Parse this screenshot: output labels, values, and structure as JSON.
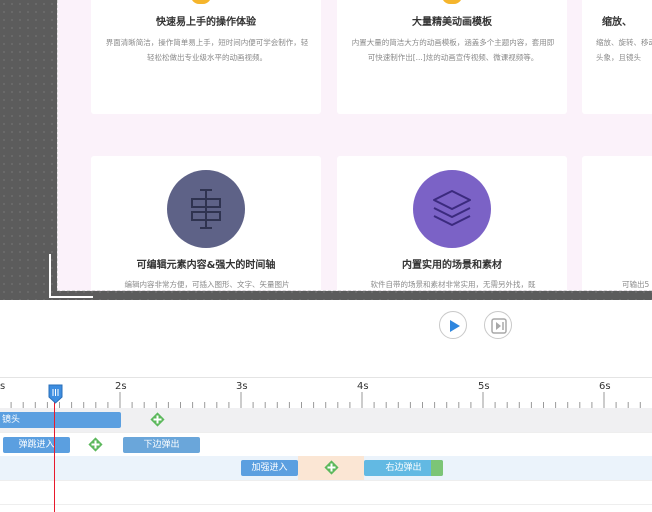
{
  "cards": [
    {
      "title": "快速易上手的操作体验",
      "desc": "界面清晰简洁，操作简单易上手，短时间内便可学会制作，轻轻松松做出专业级水平的动画视频。"
    },
    {
      "title": "大量精美动画模板",
      "desc": "内置大量的简洁大方的动画模板，涵盖多个主题内容，套用即可快速制作出[...]炫的动画宣传视频、微课视频等。"
    },
    {
      "title": "缩放、",
      "desc": "缩放、旋转、移动头象，且镜头"
    },
    {
      "title": "可编辑元素内容&强大的时间轴",
      "desc": "编辑内容非常方便，可插入图形、文字、矢量图片",
      "icon": "signpost-icon",
      "icon_color": "#5e6287"
    },
    {
      "title": "内置实用的场景和素材",
      "desc": "软件自带的场景和素材非常实用，无需另外找，既",
      "icon": "layers-icon",
      "icon_color": "#7b62c6"
    },
    {
      "title": "",
      "desc": "可输出5"
    }
  ],
  "controls": {
    "play_icon": "play-icon",
    "next_icon": "next-frame-icon",
    "accent": "#2e86de"
  },
  "ruler": {
    "labels": [
      "s",
      "2s",
      "3s",
      "4s",
      "5s",
      "6s"
    ]
  },
  "tracks": [
    {
      "blocks": [
        {
          "label": "镜头",
          "color": "#5b9fe0"
        }
      ]
    },
    {
      "blocks": [
        {
          "label": "弹跳进入",
          "color": "#5b9fe0"
        },
        {
          "label": "下边弹出",
          "color": "#6aa6da"
        }
      ]
    },
    {
      "blocks": [
        {
          "label": "加强进入",
          "color": "#5b9fe0"
        },
        {
          "label": "右边弹出",
          "color": "#62b9e3"
        }
      ]
    }
  ],
  "colors": {
    "add_green": "#5cb85c",
    "playhead": "#e8192c",
    "track_bg": "#ebf3fb"
  }
}
